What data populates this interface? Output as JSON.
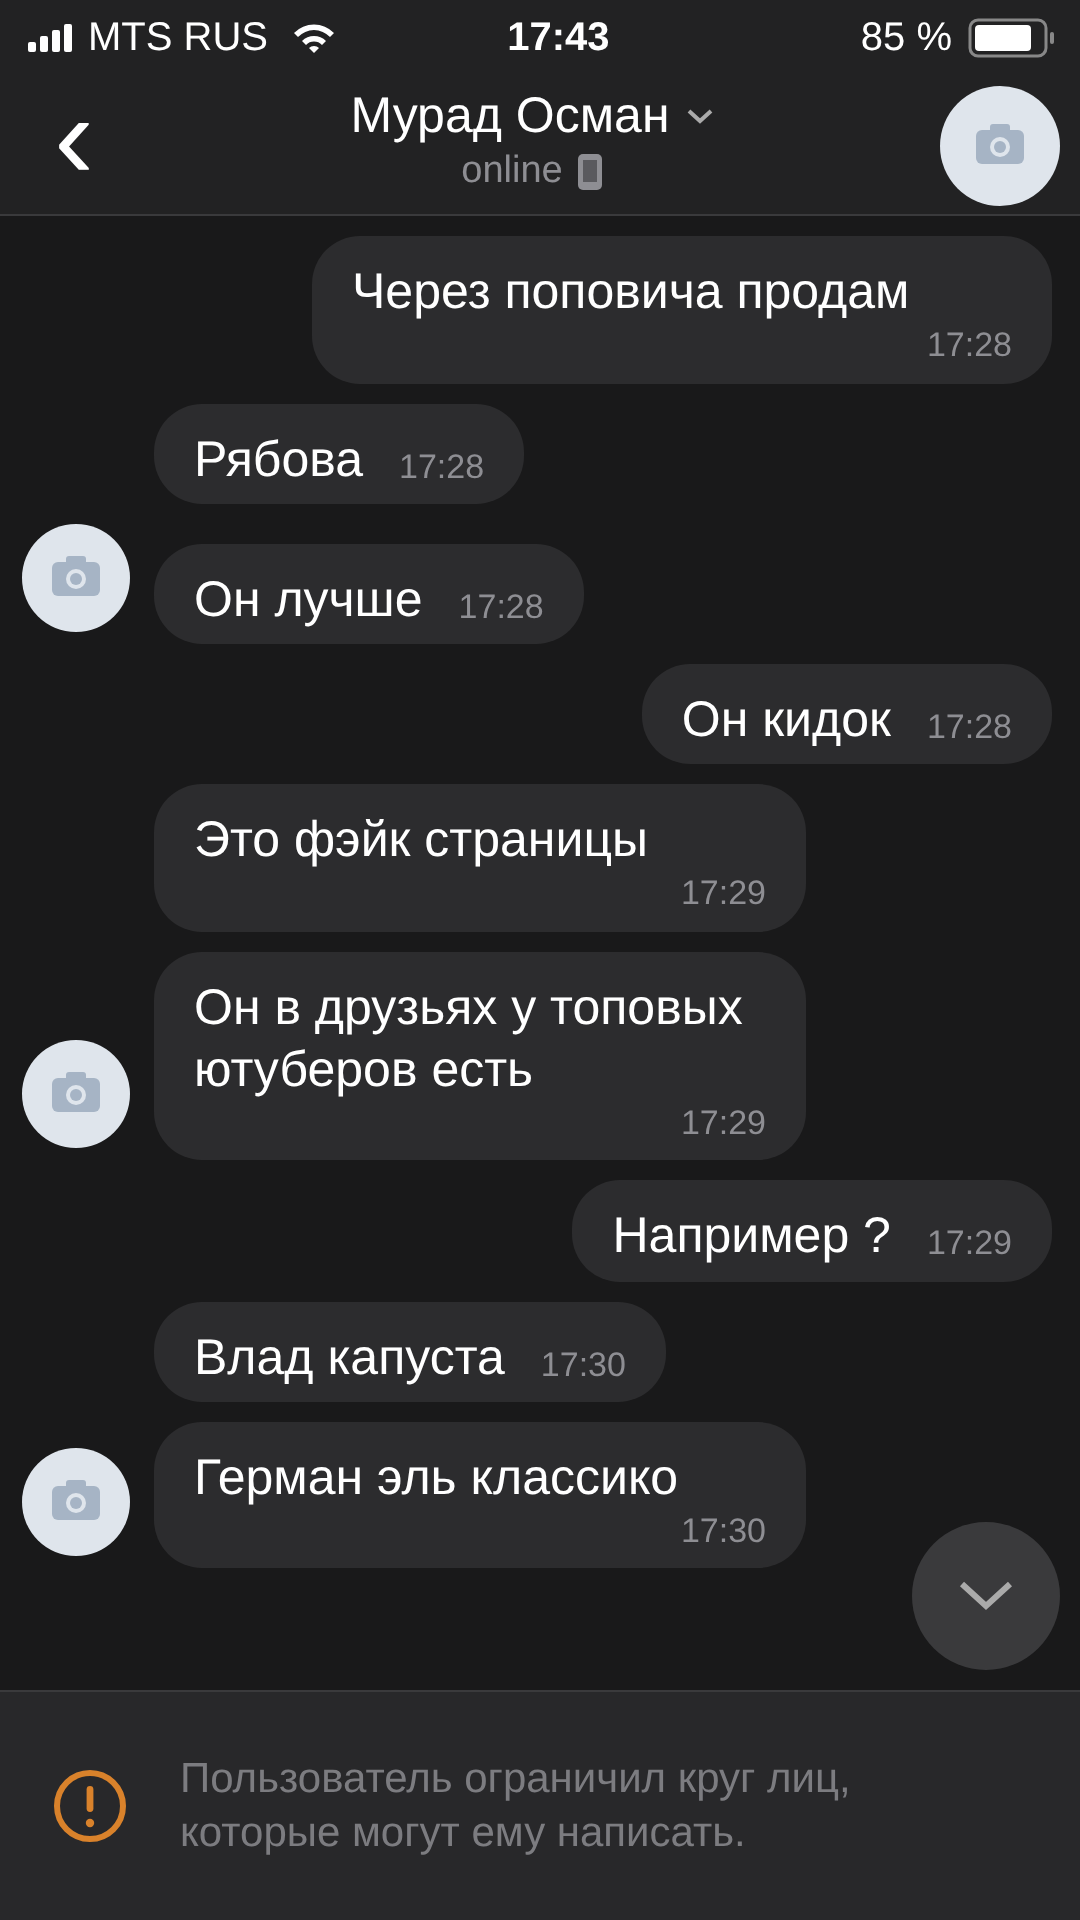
{
  "status_bar": {
    "carrier": "MTS RUS",
    "time": "17:43",
    "battery": "85 %"
  },
  "header": {
    "back": "‹",
    "title": "Мурад Осман",
    "subtitle": "online"
  },
  "messages": [
    {
      "kind": "out",
      "text": "Через поповича продам",
      "time": "17:28"
    },
    {
      "kind": "in",
      "text": "Рябова",
      "time": "17:28",
      "avatar": false
    },
    {
      "kind": "in",
      "text": "Он лучше",
      "time": "17:28",
      "avatar": true
    },
    {
      "kind": "out",
      "text": "Он кидок",
      "time": "17:28"
    },
    {
      "kind": "in",
      "text": "Это фэйк страницы",
      "time": "17:29",
      "avatar": false
    },
    {
      "kind": "in",
      "text": "Он в друзьях у топовых ютуберов есть",
      "time": "17:29",
      "avatar": true
    },
    {
      "kind": "out",
      "text": "Например ?",
      "time": "17:29"
    },
    {
      "kind": "in",
      "text": "Влад капуста",
      "time": "17:30",
      "avatar": false
    },
    {
      "kind": "in",
      "text": "Герман эль классико",
      "time": "17:30",
      "avatar": true
    }
  ],
  "notice": {
    "text": "Пользователь ограничил круг лиц, которые могут ему написать."
  }
}
